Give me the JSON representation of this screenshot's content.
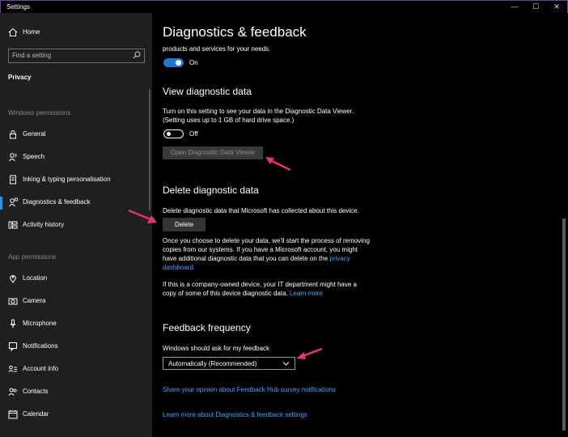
{
  "window": {
    "title": "Settings"
  },
  "sidebar": {
    "home_label": "Home",
    "search_placeholder": "Find a setting",
    "privacy_label": "Privacy",
    "section_windows": "Windows permissions",
    "windows_items": [
      {
        "label": "General",
        "icon": "lock-icon"
      },
      {
        "label": "Speech",
        "icon": "speech-icon"
      },
      {
        "label": "Inking & typing personalisation",
        "icon": "inking-icon"
      },
      {
        "label": "Diagnostics & feedback",
        "icon": "diagnostics-icon",
        "active": true
      },
      {
        "label": "Activity history",
        "icon": "activity-history-icon"
      }
    ],
    "section_app": "App permissions",
    "app_items": [
      {
        "label": "Location",
        "icon": "location-icon"
      },
      {
        "label": "Camera",
        "icon": "camera-icon"
      },
      {
        "label": "Microphone",
        "icon": "microphone-icon"
      },
      {
        "label": "Notifications",
        "icon": "notifications-icon"
      },
      {
        "label": "Account info",
        "icon": "account-info-icon"
      },
      {
        "label": "Contacts",
        "icon": "contacts-icon"
      },
      {
        "label": "Calendar",
        "icon": "calendar-icon"
      }
    ]
  },
  "main": {
    "title": "Diagnostics & feedback",
    "top_text": "products and services for your needs.",
    "top_toggle_label": "On",
    "view": {
      "heading": "View diagnostic data",
      "desc1": "Turn on this setting to see your data in the Diagnostic Data Viewer.",
      "desc2": "(Setting uses up to 1 GB of hard drive space.)",
      "toggle_label": "Off",
      "button": "Open Diagnostic Data Viewer"
    },
    "delete": {
      "heading": "Delete diagnostic data",
      "desc": "Delete diagnostic data that Microsoft has collected about this device.",
      "button": "Delete",
      "p1_l1": "Once you choose to delete your data, we'll start the process of removing",
      "p1_l2": "copies from our systems. If you have a Microsoft account, you might",
      "p1_l3": "have additional diagnostic data that you can delete on the",
      "p1_link_a": "privacy",
      "p1_link_b": "dashboard.",
      "p2_l1": "If this is a company-owned device, your IT department might have a",
      "p2_l2": "copy of some of this device diagnostic data.",
      "p2_link": "Learn more"
    },
    "feedback": {
      "heading": "Feedback frequency",
      "label": "Windows should ask for my feedback",
      "selected": "Automatically (Recommended)"
    },
    "link_hub": "Share your opinion about Feedback Hub survey notifications",
    "link_learn": "Learn more about Diagnostics & feedback settings"
  },
  "colors": {
    "accent": "#1f76d2",
    "link": "#4aa3ff",
    "annotation_arrow": "#e8336d"
  }
}
